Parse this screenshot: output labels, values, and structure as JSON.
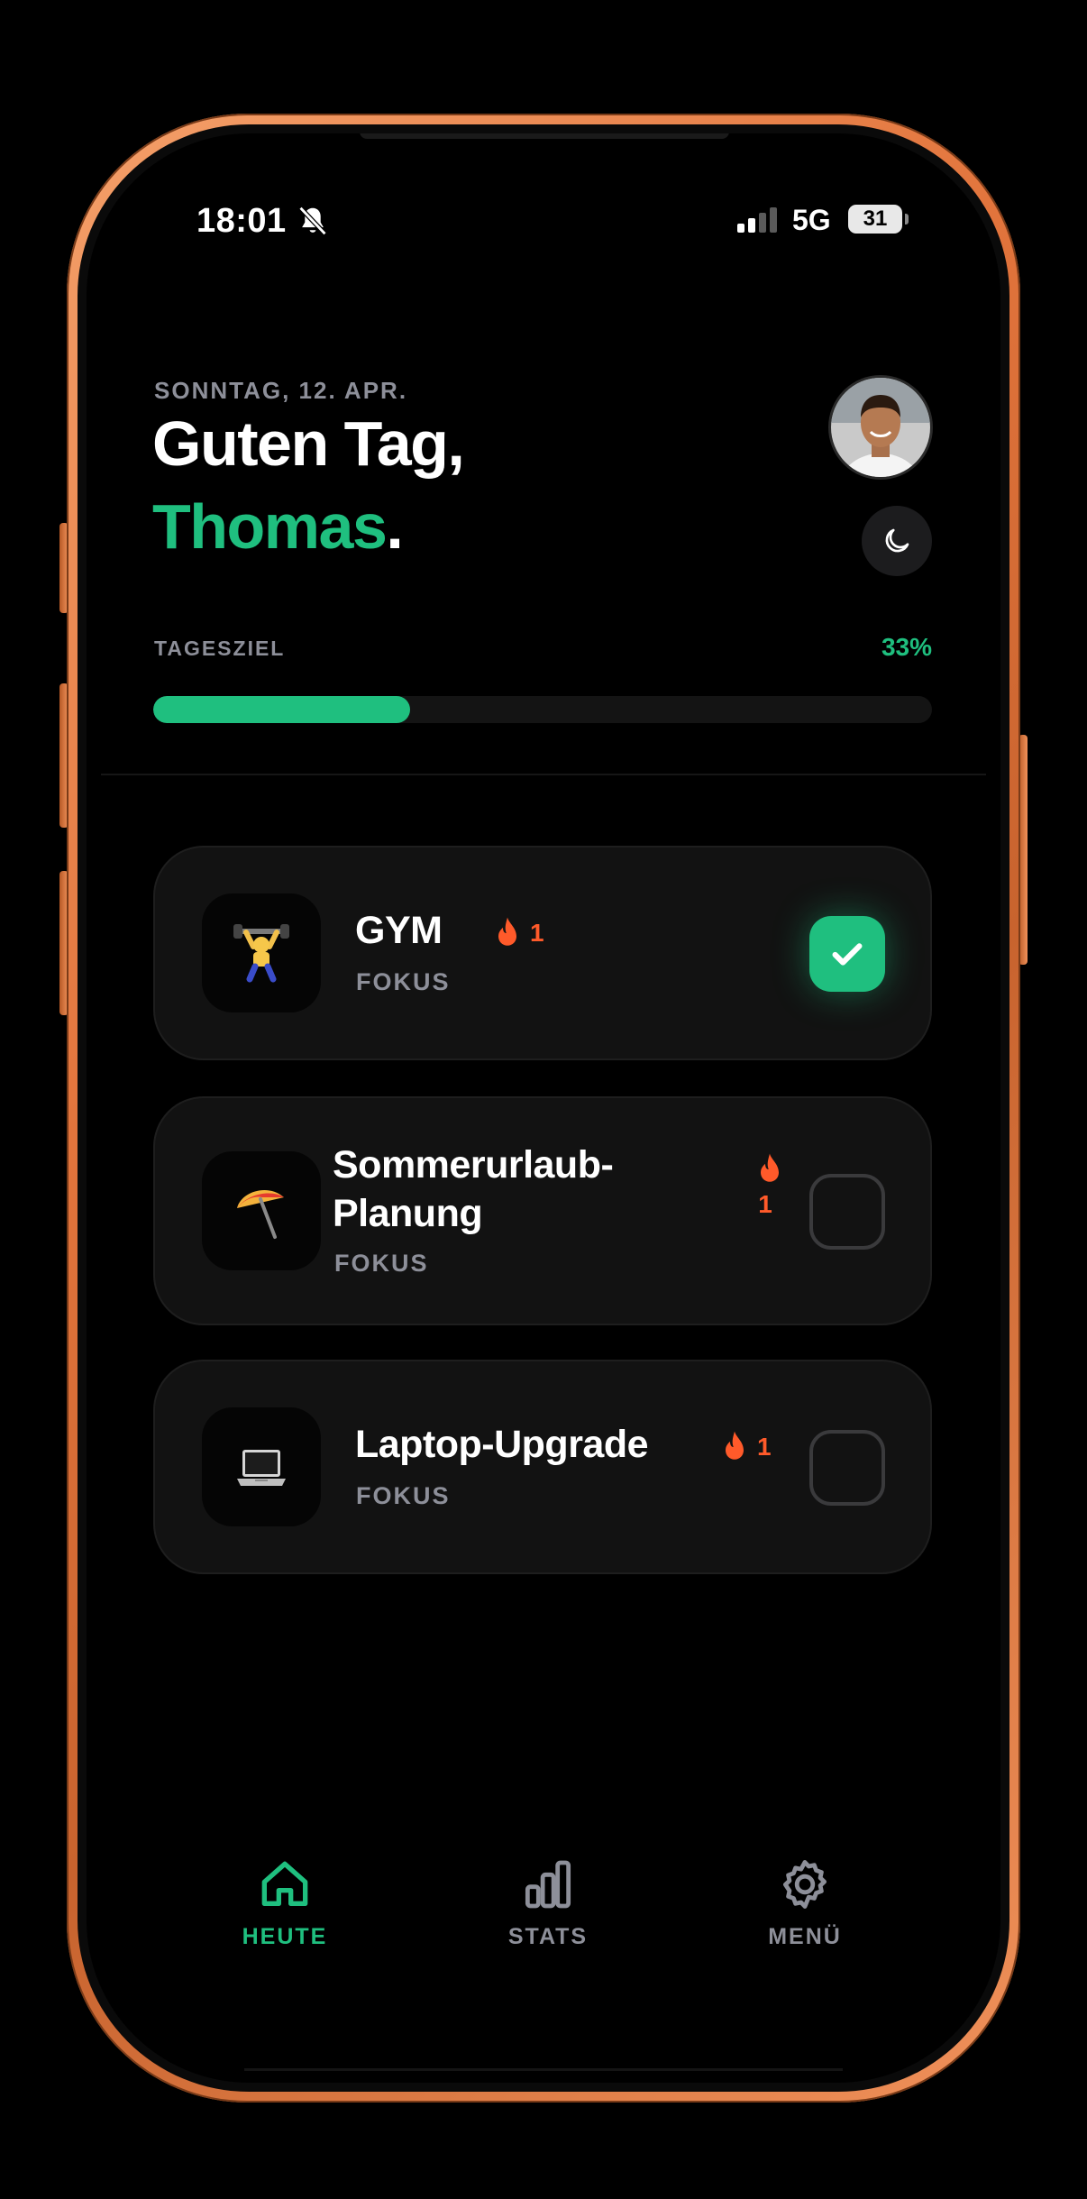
{
  "status_bar": {
    "time": "18:01",
    "network": "5G",
    "battery": "31"
  },
  "header": {
    "date": "SONNTAG, 12. APR.",
    "greeting_line1": "Guten Tag,",
    "user_name": "Thomas",
    "greeting_suffix": "."
  },
  "goal": {
    "label": "TAGESZIEL",
    "percent_text": "33%",
    "progress_fraction": 0.33
  },
  "tasks": [
    {
      "title": "GYM",
      "category": "FOKUS",
      "streak": "1",
      "done": true,
      "icon": "weightlifter-emoji"
    },
    {
      "title_line1": "Sommerurlaub-",
      "title_line2": "Planung",
      "category": "FOKUS",
      "streak": "1",
      "done": false,
      "icon": "beach-umbrella-emoji"
    },
    {
      "title": "Laptop-Upgrade",
      "category": "FOKUS",
      "streak": "1",
      "done": false,
      "icon": "laptop-emoji"
    }
  ],
  "tab_bar": {
    "tabs": [
      {
        "label": "HEUTE",
        "icon": "home-icon",
        "active": true
      },
      {
        "label": "STATS",
        "icon": "bar-chart-icon",
        "active": false
      },
      {
        "label": "MENÜ",
        "icon": "gear-icon",
        "active": false
      }
    ]
  },
  "colors": {
    "accent": "#1fbf7f",
    "streak": "#ff5a2a",
    "card": "#121212",
    "muted": "#8d8f99",
    "frame": "#e2743c"
  }
}
